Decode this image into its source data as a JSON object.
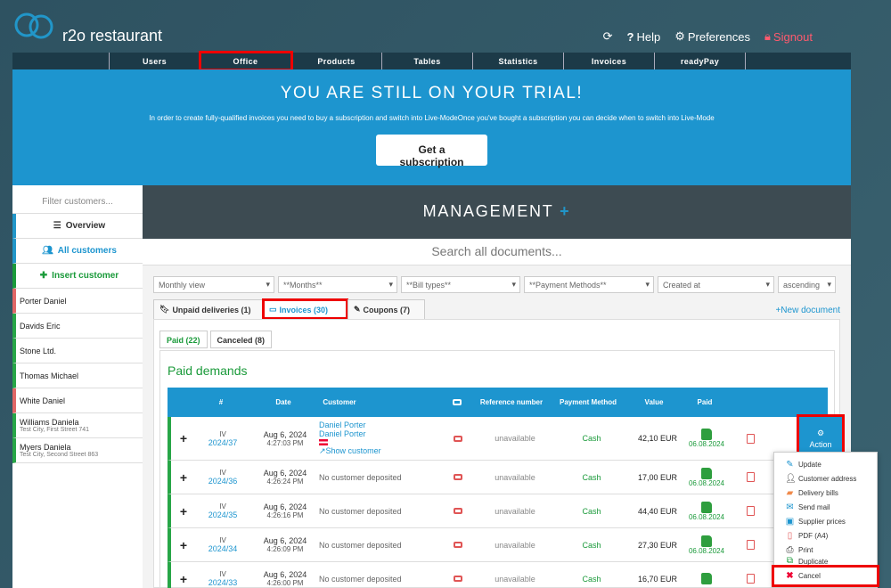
{
  "app": {
    "brand": "r2o restaurant"
  },
  "topnav": {
    "help": "Help",
    "preferences": "Preferences",
    "signout": "Signout"
  },
  "mainnav": [
    "Users",
    "Office",
    "Products",
    "Tables",
    "Statistics",
    "Invoices",
    "readyPay"
  ],
  "trial": {
    "title": "YOU ARE STILL ON YOUR TRIAL!",
    "text": "In order to create fully-qualified invoices you need to buy a subscription and switch into Live-ModeOnce you've bought a subscription you can decide when to switch into Live-Mode",
    "button": "Get a subscription"
  },
  "sidebar": {
    "filter_placeholder": "Filter customers...",
    "overview": "Overview",
    "all_customers": "All customers",
    "insert_customer": "Insert customer",
    "customers": [
      {
        "name": "Porter Daniel",
        "sub": ""
      },
      {
        "name": "Davids Eric",
        "sub": ""
      },
      {
        "name": "Stone Ltd.",
        "sub": ""
      },
      {
        "name": "Thomas Michael",
        "sub": ""
      },
      {
        "name": "White Daniel",
        "sub": ""
      },
      {
        "name": "Williams Daniela",
        "sub": "Test City, First Street 741"
      },
      {
        "name": "Myers Daniela",
        "sub": "Test City, Second Street 863"
      }
    ]
  },
  "management": {
    "title": "MANAGEMENT",
    "plus": "+",
    "search": "Search all documents..."
  },
  "filters": [
    "Monthly view",
    "**Months**",
    "**Bill types**",
    "**Payment Methods**",
    "Created at",
    "ascending"
  ],
  "tabs": {
    "unpaid": "Unpaid deliveries (1)",
    "invoices": "Invoices (30)",
    "coupons": "Coupons (7)",
    "new_document": "New document"
  },
  "subtabs": {
    "paid": "Paid (22)",
    "canceled": "Canceled (8)"
  },
  "paid_title": "Paid demands",
  "table": {
    "headers": {
      "num": "#",
      "date": "Date",
      "customer": "Customer",
      "ref": "Reference number",
      "payment": "Payment Method",
      "value": "Value",
      "paid": "Paid"
    },
    "rows": [
      {
        "type": "IV",
        "num": "2024/37",
        "date": "Aug 6, 2024",
        "time": "4:27:03 PM",
        "customer1": "Daniel Porter",
        "customer2": "Daniel Porter",
        "show": "Show customer",
        "ref": "unavailable",
        "method": "Cash",
        "value": "42,10 EUR",
        "paid": "06.08.2024"
      },
      {
        "type": "IV",
        "num": "2024/36",
        "date": "Aug 6, 2024",
        "time": "4:26:24 PM",
        "customer1": "No customer deposited",
        "ref": "unavailable",
        "method": "Cash",
        "value": "17,00 EUR",
        "paid": "06.08.2024"
      },
      {
        "type": "IV",
        "num": "2024/35",
        "date": "Aug 6, 2024",
        "time": "4:26:16 PM",
        "customer1": "No customer deposited",
        "ref": "unavailable",
        "method": "Cash",
        "value": "44,40 EUR",
        "paid": "06.08.2024"
      },
      {
        "type": "IV",
        "num": "2024/34",
        "date": "Aug 6, 2024",
        "time": "4:26:09 PM",
        "customer1": "No customer deposited",
        "ref": "unavailable",
        "method": "Cash",
        "value": "27,30 EUR",
        "paid": "06.08.2024"
      },
      {
        "type": "IV",
        "num": "2024/33",
        "date": "Aug 6, 2024",
        "time": "4:26:00 PM",
        "customer1": "No customer deposited",
        "ref": "unavailable",
        "method": "Cash",
        "value": "16,70 EUR",
        "paid": ""
      }
    ]
  },
  "action": {
    "label": "Action"
  },
  "menu": [
    "Update",
    "Customer address",
    "Delivery bills",
    "Send mail",
    "Supplier prices",
    "PDF (A4)",
    "Print",
    "Duplicate",
    "Cancel"
  ]
}
